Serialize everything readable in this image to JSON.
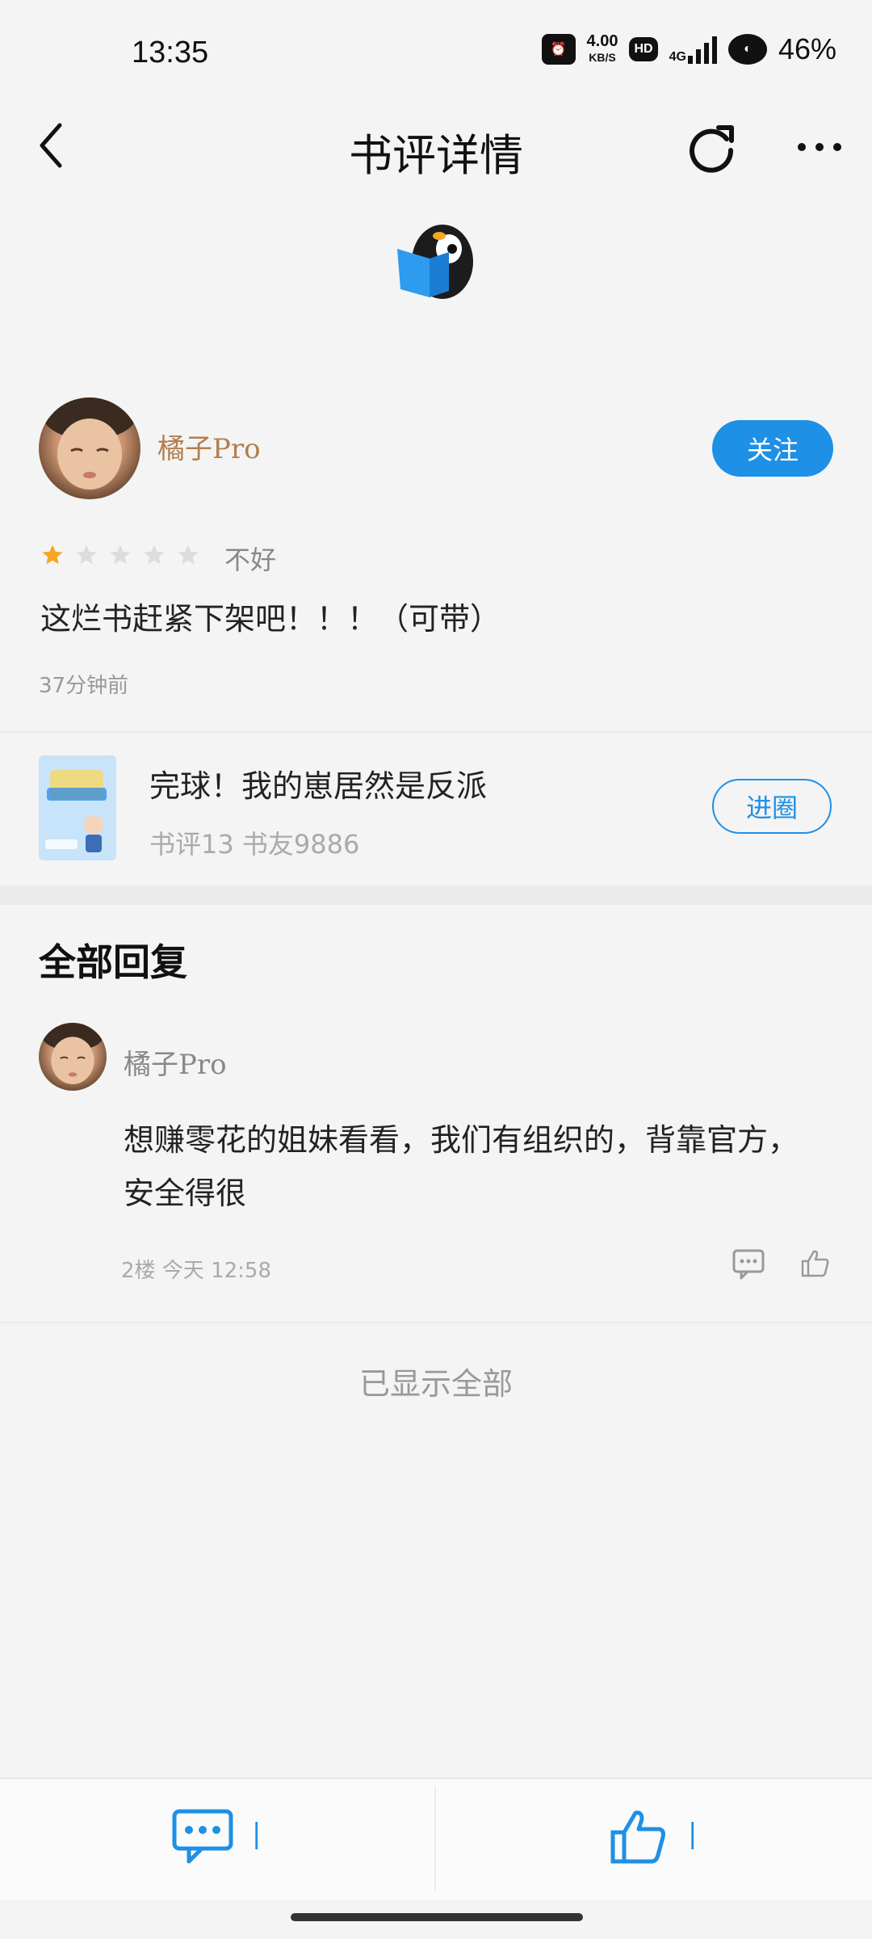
{
  "status_bar": {
    "time": "13:35",
    "net_speed_value": "4.00",
    "net_speed_unit": "KB/S",
    "hd_badge": "HD",
    "network_type": "4G",
    "battery": "46%"
  },
  "nav": {
    "title": "书评详情",
    "back_icon": "chevron-left-icon",
    "refresh_icon": "refresh-icon",
    "more_icon": "more-horizontal-icon"
  },
  "review": {
    "user_name": "橘子Pro",
    "follow_label": "关注",
    "rating": 1,
    "rating_max": 5,
    "rating_label": "不好",
    "text": "这烂书赶紧下架吧！！！（可带）",
    "time": "37分钟前"
  },
  "book": {
    "title": "完球！我的崽居然是反派",
    "stats": "书评13  书友9886",
    "circle_button_label": "进圈"
  },
  "replies_section": {
    "title": "全部回复",
    "replies": [
      {
        "user_name": "橘子Pro",
        "text": "想赚零花的姐妹看看，我们有组织的，背靠官方，安全得很",
        "meta": "2楼  今天 12:58"
      }
    ],
    "show_all_text": "已显示全部"
  },
  "bottom_bar": {
    "comment_count": "|",
    "like_count": "|"
  },
  "colors": {
    "accent": "#1e90e6",
    "username": "#b37d4e",
    "star_active": "#f5a623",
    "star_inactive": "#dddddd"
  }
}
